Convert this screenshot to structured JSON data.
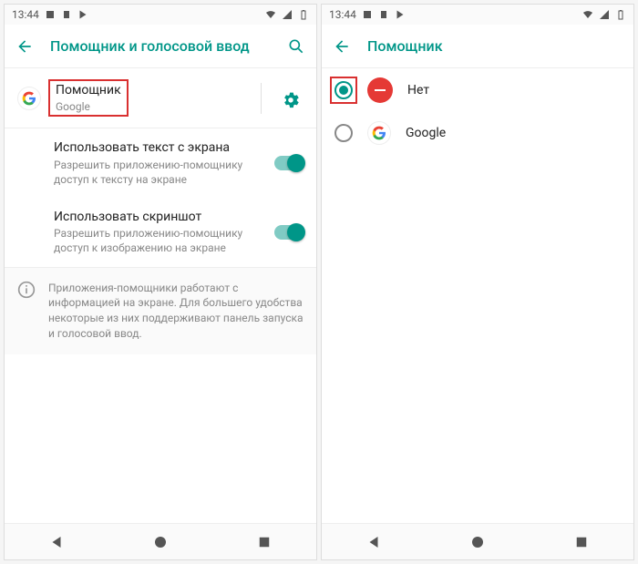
{
  "status": {
    "time": "13:44"
  },
  "left": {
    "title": "Помощник и голосовой ввод",
    "assistant": {
      "title": "Помощник",
      "sub": "Google"
    },
    "useText": {
      "title": "Использовать текст с экрана",
      "sub": "Разрешить приложению-помощнику доступ к тексту на экране"
    },
    "useScreenshot": {
      "title": "Использовать скриншот",
      "sub": "Разрешить приложению-помощнику доступ к изображению на экране"
    },
    "info": "Приложения-помощники работают с информацией на экране. Для большего удобства некоторые из них поддерживают панель запуска и голосовой ввод."
  },
  "right": {
    "title": "Помощник",
    "options": {
      "none": "Нет",
      "google": "Google"
    }
  }
}
